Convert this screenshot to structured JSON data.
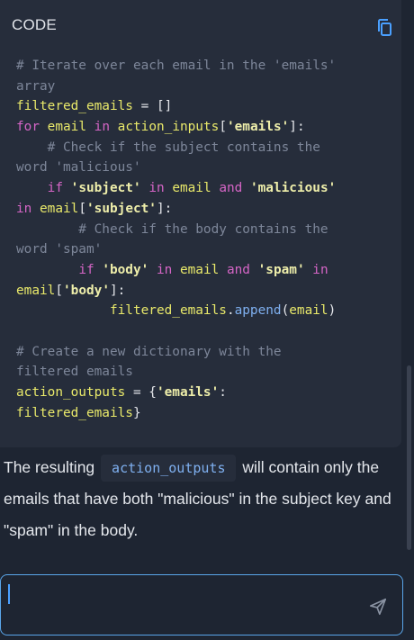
{
  "code_block": {
    "header": "CODE",
    "copy_icon": "copy-icon",
    "lines": [
      {
        "tokens": [
          {
            "t": "cm",
            "v": "# Iterate over each email in the 'emails'"
          }
        ]
      },
      {
        "tokens": [
          {
            "t": "cm",
            "v": "array"
          }
        ]
      },
      {
        "tokens": [
          {
            "t": "id",
            "v": "filtered_emails"
          },
          {
            "t": "pu",
            "v": " = []"
          }
        ]
      },
      {
        "tokens": [
          {
            "t": "kw",
            "v": "for"
          },
          {
            "t": "pu",
            "v": " "
          },
          {
            "t": "id",
            "v": "email"
          },
          {
            "t": "pu",
            "v": " "
          },
          {
            "t": "kw",
            "v": "in"
          },
          {
            "t": "pu",
            "v": " "
          },
          {
            "t": "id",
            "v": "action_inputs"
          },
          {
            "t": "pu",
            "v": "["
          },
          {
            "t": "st",
            "v": "'emails'"
          },
          {
            "t": "pu",
            "v": "]:"
          }
        ]
      },
      {
        "tokens": [
          {
            "t": "cm",
            "v": "    # Check if the subject contains the"
          }
        ]
      },
      {
        "tokens": [
          {
            "t": "cm",
            "v": "word 'malicious'"
          }
        ]
      },
      {
        "tokens": [
          {
            "t": "pu",
            "v": "    "
          },
          {
            "t": "kw",
            "v": "if"
          },
          {
            "t": "pu",
            "v": " "
          },
          {
            "t": "st",
            "v": "'subject'"
          },
          {
            "t": "pu",
            "v": " "
          },
          {
            "t": "kw",
            "v": "in"
          },
          {
            "t": "pu",
            "v": " "
          },
          {
            "t": "id",
            "v": "email"
          },
          {
            "t": "pu",
            "v": " "
          },
          {
            "t": "kw",
            "v": "and"
          },
          {
            "t": "pu",
            "v": " "
          },
          {
            "t": "st",
            "v": "'malicious'"
          }
        ]
      },
      {
        "tokens": [
          {
            "t": "kw",
            "v": "in"
          },
          {
            "t": "pu",
            "v": " "
          },
          {
            "t": "id",
            "v": "email"
          },
          {
            "t": "pu",
            "v": "["
          },
          {
            "t": "st",
            "v": "'subject'"
          },
          {
            "t": "pu",
            "v": "]:"
          }
        ]
      },
      {
        "tokens": [
          {
            "t": "cm",
            "v": "        # Check if the body contains the"
          }
        ]
      },
      {
        "tokens": [
          {
            "t": "cm",
            "v": "word 'spam'"
          }
        ]
      },
      {
        "tokens": [
          {
            "t": "pu",
            "v": "        "
          },
          {
            "t": "kw",
            "v": "if"
          },
          {
            "t": "pu",
            "v": " "
          },
          {
            "t": "st",
            "v": "'body'"
          },
          {
            "t": "pu",
            "v": " "
          },
          {
            "t": "kw",
            "v": "in"
          },
          {
            "t": "pu",
            "v": " "
          },
          {
            "t": "id",
            "v": "email"
          },
          {
            "t": "pu",
            "v": " "
          },
          {
            "t": "kw",
            "v": "and"
          },
          {
            "t": "pu",
            "v": " "
          },
          {
            "t": "st",
            "v": "'spam'"
          },
          {
            "t": "pu",
            "v": " "
          },
          {
            "t": "kw",
            "v": "in"
          }
        ]
      },
      {
        "tokens": [
          {
            "t": "id",
            "v": "email"
          },
          {
            "t": "pu",
            "v": "["
          },
          {
            "t": "st",
            "v": "'body'"
          },
          {
            "t": "pu",
            "v": "]:"
          }
        ]
      },
      {
        "tokens": [
          {
            "t": "pu",
            "v": "            "
          },
          {
            "t": "id",
            "v": "filtered_emails"
          },
          {
            "t": "pu",
            "v": "."
          },
          {
            "t": "fn",
            "v": "append"
          },
          {
            "t": "pu",
            "v": "("
          },
          {
            "t": "id",
            "v": "email"
          },
          {
            "t": "pu",
            "v": ")"
          }
        ]
      },
      {
        "tokens": []
      },
      {
        "tokens": [
          {
            "t": "cm",
            "v": "# Create a new dictionary with the"
          }
        ]
      },
      {
        "tokens": [
          {
            "t": "cm",
            "v": "filtered emails"
          }
        ]
      },
      {
        "tokens": [
          {
            "t": "id",
            "v": "action_outputs"
          },
          {
            "t": "pu",
            "v": " = {"
          },
          {
            "t": "st",
            "v": "'emails'"
          },
          {
            "t": "pu",
            "v": ":"
          }
        ]
      },
      {
        "tokens": [
          {
            "t": "id",
            "v": "filtered_emails"
          },
          {
            "t": "pu",
            "v": "}"
          }
        ]
      }
    ]
  },
  "answer": {
    "prefix": "The resulting",
    "inline_code": "action_outputs",
    "suffix": "will contain only the emails that have both \"malicious\" in the subject key and \"spam\" in the body."
  },
  "input": {
    "value": "",
    "placeholder": "",
    "send_icon": "send-icon"
  },
  "colors": {
    "background": "#1e2532",
    "code_background": "#262d3b",
    "accent": "#4aa0ff",
    "keyword": "#d565c6",
    "identifier": "#e9e96a",
    "comment": "#7d8699",
    "function": "#7fb0f0"
  }
}
